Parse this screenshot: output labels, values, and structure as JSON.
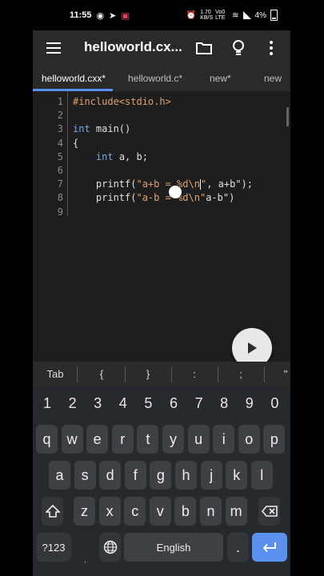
{
  "status_bar": {
    "time": "11:55",
    "net_speed": "1.70 KB/S",
    "network_label": "Vo0 LTE",
    "battery": "4%"
  },
  "toolbar": {
    "title": "helloworld.cx..."
  },
  "tabs": [
    {
      "label": "helloworld.cxx*",
      "active": true
    },
    {
      "label": "helloworld.c*",
      "active": false
    },
    {
      "label": "new*",
      "active": false
    },
    {
      "label": "new",
      "active": false
    }
  ],
  "editor": {
    "line_numbers": [
      "1",
      "2",
      "3",
      "4",
      "5",
      "6",
      "7",
      "8",
      "9"
    ],
    "lines": [
      {
        "parts": [
          {
            "t": "#include<stdio.h>",
            "c": "kw-inc"
          }
        ]
      },
      {
        "parts": []
      },
      {
        "parts": [
          {
            "t": "int",
            "c": "kw"
          },
          {
            "t": " main()",
            "c": "plain"
          }
        ]
      },
      {
        "parts": [
          {
            "t": "{",
            "c": "plain"
          }
        ]
      },
      {
        "parts": [
          {
            "t": "    ",
            "c": "plain"
          },
          {
            "t": "int",
            "c": "kw"
          },
          {
            "t": " a, b;",
            "c": "plain"
          }
        ]
      },
      {
        "parts": []
      },
      {
        "parts": [
          {
            "t": "    printf(",
            "c": "plain"
          },
          {
            "t": "\"a+b = %d\\n",
            "c": "str"
          },
          {
            "t": "CURSOR",
            "c": "cursor"
          },
          {
            "t": "\"",
            "c": "str"
          },
          {
            "t": ", a+b\");",
            "c": "plain"
          }
        ]
      },
      {
        "parts": [
          {
            "t": "    printf(",
            "c": "plain"
          },
          {
            "t": "\"a-b = %d\\n\"",
            "c": "str"
          },
          {
            "t": "a-b\")",
            "c": "plain"
          }
        ]
      },
      {
        "parts": []
      }
    ]
  },
  "symbol_bar": [
    "Tab",
    "{",
    "}",
    ":",
    ";",
    "\""
  ],
  "keyboard": {
    "numbers": [
      "1",
      "2",
      "3",
      "4",
      "5",
      "6",
      "7",
      "8",
      "9",
      "0"
    ],
    "row1": [
      "q",
      "w",
      "e",
      "r",
      "t",
      "y",
      "u",
      "i",
      "o",
      "p"
    ],
    "row2": [
      "a",
      "s",
      "d",
      "f",
      "g",
      "h",
      "j",
      "k",
      "l"
    ],
    "row3": [
      "z",
      "x",
      "c",
      "v",
      "b",
      "n",
      "m"
    ],
    "mode_label": "?123",
    "space_label": "English",
    "period": ".",
    "comma": ","
  }
}
